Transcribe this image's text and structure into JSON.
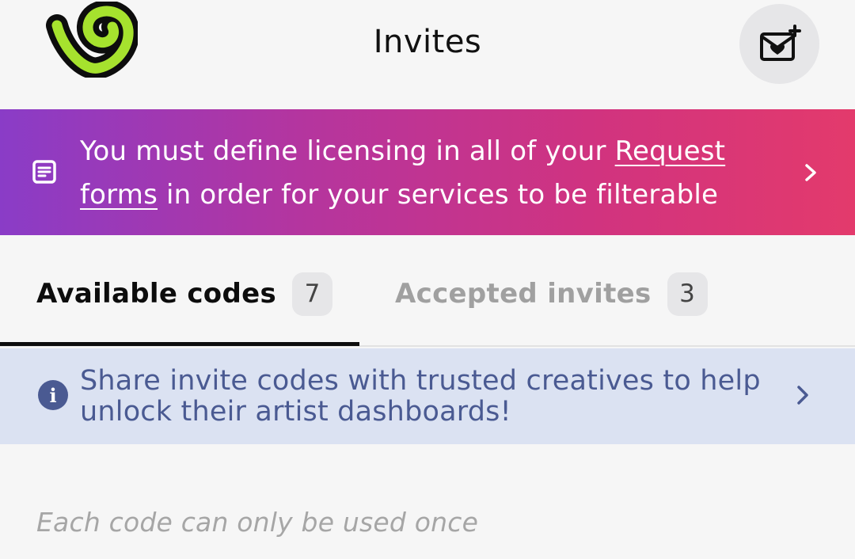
{
  "header": {
    "title": "Invites",
    "logo_icon": "brand-logo",
    "compose_icon": "mail-heart-plus-icon"
  },
  "banner": {
    "text_before": "You must define licensing in all of your ",
    "link_text": "Request forms",
    "text_after": " in order for your services to be filterable",
    "icon": "document-icon",
    "gradient_start": "#8a3cc7",
    "gradient_end": "#e33a6c"
  },
  "tabs": [
    {
      "label": "Available codes",
      "count": "7",
      "active": true
    },
    {
      "label": "Accepted invites",
      "count": "3",
      "active": false
    }
  ],
  "info": {
    "text": "Share invite codes with trusted creatives to help unlock their artist dashboards!",
    "icon": "info-icon",
    "color": "#4a5a92",
    "background": "#dbe2f2"
  },
  "note": "Each code can only be used once"
}
